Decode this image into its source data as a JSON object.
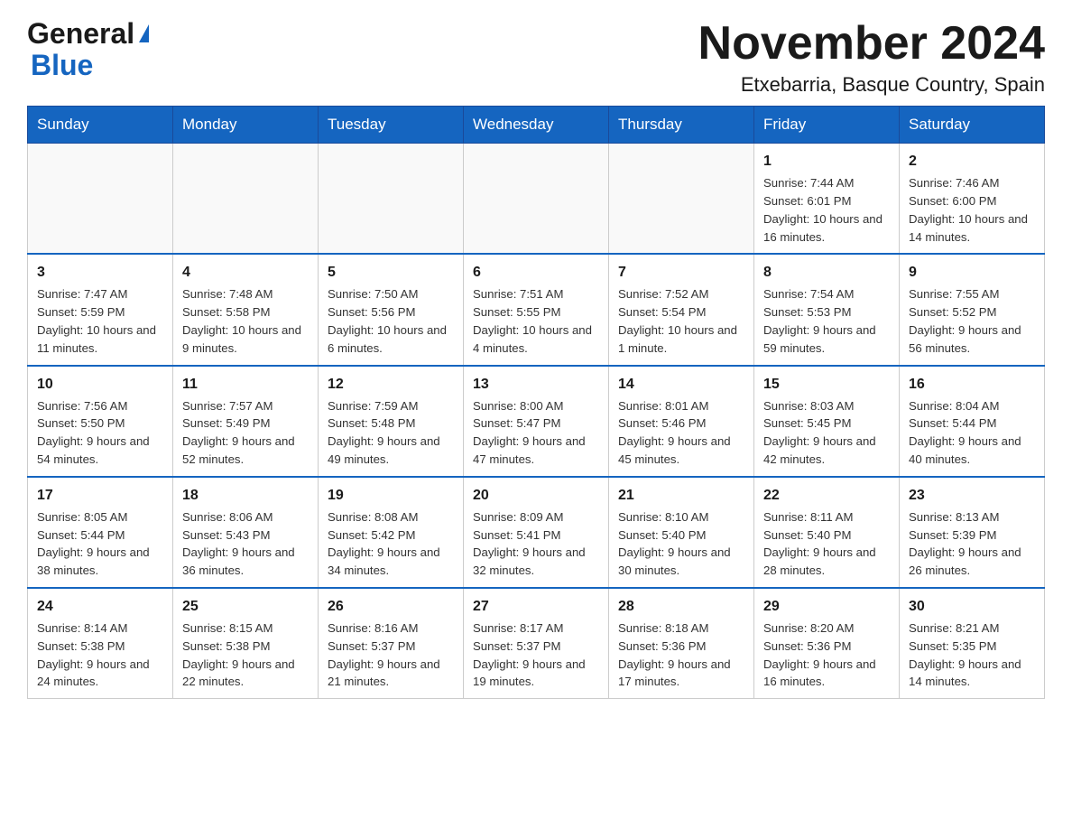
{
  "logo": {
    "general": "General",
    "blue": "Blue"
  },
  "title": "November 2024",
  "location": "Etxebarria, Basque Country, Spain",
  "days_of_week": [
    "Sunday",
    "Monday",
    "Tuesday",
    "Wednesday",
    "Thursday",
    "Friday",
    "Saturday"
  ],
  "weeks": [
    [
      {
        "day": "",
        "info": ""
      },
      {
        "day": "",
        "info": ""
      },
      {
        "day": "",
        "info": ""
      },
      {
        "day": "",
        "info": ""
      },
      {
        "day": "",
        "info": ""
      },
      {
        "day": "1",
        "info": "Sunrise: 7:44 AM\nSunset: 6:01 PM\nDaylight: 10 hours and 16 minutes."
      },
      {
        "day": "2",
        "info": "Sunrise: 7:46 AM\nSunset: 6:00 PM\nDaylight: 10 hours and 14 minutes."
      }
    ],
    [
      {
        "day": "3",
        "info": "Sunrise: 7:47 AM\nSunset: 5:59 PM\nDaylight: 10 hours and 11 minutes."
      },
      {
        "day": "4",
        "info": "Sunrise: 7:48 AM\nSunset: 5:58 PM\nDaylight: 10 hours and 9 minutes."
      },
      {
        "day": "5",
        "info": "Sunrise: 7:50 AM\nSunset: 5:56 PM\nDaylight: 10 hours and 6 minutes."
      },
      {
        "day": "6",
        "info": "Sunrise: 7:51 AM\nSunset: 5:55 PM\nDaylight: 10 hours and 4 minutes."
      },
      {
        "day": "7",
        "info": "Sunrise: 7:52 AM\nSunset: 5:54 PM\nDaylight: 10 hours and 1 minute."
      },
      {
        "day": "8",
        "info": "Sunrise: 7:54 AM\nSunset: 5:53 PM\nDaylight: 9 hours and 59 minutes."
      },
      {
        "day": "9",
        "info": "Sunrise: 7:55 AM\nSunset: 5:52 PM\nDaylight: 9 hours and 56 minutes."
      }
    ],
    [
      {
        "day": "10",
        "info": "Sunrise: 7:56 AM\nSunset: 5:50 PM\nDaylight: 9 hours and 54 minutes."
      },
      {
        "day": "11",
        "info": "Sunrise: 7:57 AM\nSunset: 5:49 PM\nDaylight: 9 hours and 52 minutes."
      },
      {
        "day": "12",
        "info": "Sunrise: 7:59 AM\nSunset: 5:48 PM\nDaylight: 9 hours and 49 minutes."
      },
      {
        "day": "13",
        "info": "Sunrise: 8:00 AM\nSunset: 5:47 PM\nDaylight: 9 hours and 47 minutes."
      },
      {
        "day": "14",
        "info": "Sunrise: 8:01 AM\nSunset: 5:46 PM\nDaylight: 9 hours and 45 minutes."
      },
      {
        "day": "15",
        "info": "Sunrise: 8:03 AM\nSunset: 5:45 PM\nDaylight: 9 hours and 42 minutes."
      },
      {
        "day": "16",
        "info": "Sunrise: 8:04 AM\nSunset: 5:44 PM\nDaylight: 9 hours and 40 minutes."
      }
    ],
    [
      {
        "day": "17",
        "info": "Sunrise: 8:05 AM\nSunset: 5:44 PM\nDaylight: 9 hours and 38 minutes."
      },
      {
        "day": "18",
        "info": "Sunrise: 8:06 AM\nSunset: 5:43 PM\nDaylight: 9 hours and 36 minutes."
      },
      {
        "day": "19",
        "info": "Sunrise: 8:08 AM\nSunset: 5:42 PM\nDaylight: 9 hours and 34 minutes."
      },
      {
        "day": "20",
        "info": "Sunrise: 8:09 AM\nSunset: 5:41 PM\nDaylight: 9 hours and 32 minutes."
      },
      {
        "day": "21",
        "info": "Sunrise: 8:10 AM\nSunset: 5:40 PM\nDaylight: 9 hours and 30 minutes."
      },
      {
        "day": "22",
        "info": "Sunrise: 8:11 AM\nSunset: 5:40 PM\nDaylight: 9 hours and 28 minutes."
      },
      {
        "day": "23",
        "info": "Sunrise: 8:13 AM\nSunset: 5:39 PM\nDaylight: 9 hours and 26 minutes."
      }
    ],
    [
      {
        "day": "24",
        "info": "Sunrise: 8:14 AM\nSunset: 5:38 PM\nDaylight: 9 hours and 24 minutes."
      },
      {
        "day": "25",
        "info": "Sunrise: 8:15 AM\nSunset: 5:38 PM\nDaylight: 9 hours and 22 minutes."
      },
      {
        "day": "26",
        "info": "Sunrise: 8:16 AM\nSunset: 5:37 PM\nDaylight: 9 hours and 21 minutes."
      },
      {
        "day": "27",
        "info": "Sunrise: 8:17 AM\nSunset: 5:37 PM\nDaylight: 9 hours and 19 minutes."
      },
      {
        "day": "28",
        "info": "Sunrise: 8:18 AM\nSunset: 5:36 PM\nDaylight: 9 hours and 17 minutes."
      },
      {
        "day": "29",
        "info": "Sunrise: 8:20 AM\nSunset: 5:36 PM\nDaylight: 9 hours and 16 minutes."
      },
      {
        "day": "30",
        "info": "Sunrise: 8:21 AM\nSunset: 5:35 PM\nDaylight: 9 hours and 14 minutes."
      }
    ]
  ]
}
